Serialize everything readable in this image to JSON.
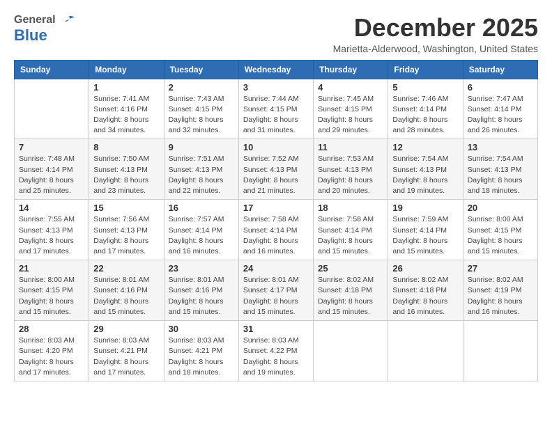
{
  "logo": {
    "general": "General",
    "blue": "Blue"
  },
  "header": {
    "month": "December 2025",
    "location": "Marietta-Alderwood, Washington, United States"
  },
  "days_of_week": [
    "Sunday",
    "Monday",
    "Tuesday",
    "Wednesday",
    "Thursday",
    "Friday",
    "Saturday"
  ],
  "weeks": [
    [
      {
        "day": "",
        "info": ""
      },
      {
        "day": "1",
        "info": "Sunrise: 7:41 AM\nSunset: 4:16 PM\nDaylight: 8 hours\nand 34 minutes."
      },
      {
        "day": "2",
        "info": "Sunrise: 7:43 AM\nSunset: 4:15 PM\nDaylight: 8 hours\nand 32 minutes."
      },
      {
        "day": "3",
        "info": "Sunrise: 7:44 AM\nSunset: 4:15 PM\nDaylight: 8 hours\nand 31 minutes."
      },
      {
        "day": "4",
        "info": "Sunrise: 7:45 AM\nSunset: 4:15 PM\nDaylight: 8 hours\nand 29 minutes."
      },
      {
        "day": "5",
        "info": "Sunrise: 7:46 AM\nSunset: 4:14 PM\nDaylight: 8 hours\nand 28 minutes."
      },
      {
        "day": "6",
        "info": "Sunrise: 7:47 AM\nSunset: 4:14 PM\nDaylight: 8 hours\nand 26 minutes."
      }
    ],
    [
      {
        "day": "7",
        "info": "Sunrise: 7:48 AM\nSunset: 4:14 PM\nDaylight: 8 hours\nand 25 minutes."
      },
      {
        "day": "8",
        "info": "Sunrise: 7:50 AM\nSunset: 4:13 PM\nDaylight: 8 hours\nand 23 minutes."
      },
      {
        "day": "9",
        "info": "Sunrise: 7:51 AM\nSunset: 4:13 PM\nDaylight: 8 hours\nand 22 minutes."
      },
      {
        "day": "10",
        "info": "Sunrise: 7:52 AM\nSunset: 4:13 PM\nDaylight: 8 hours\nand 21 minutes."
      },
      {
        "day": "11",
        "info": "Sunrise: 7:53 AM\nSunset: 4:13 PM\nDaylight: 8 hours\nand 20 minutes."
      },
      {
        "day": "12",
        "info": "Sunrise: 7:54 AM\nSunset: 4:13 PM\nDaylight: 8 hours\nand 19 minutes."
      },
      {
        "day": "13",
        "info": "Sunrise: 7:54 AM\nSunset: 4:13 PM\nDaylight: 8 hours\nand 18 minutes."
      }
    ],
    [
      {
        "day": "14",
        "info": "Sunrise: 7:55 AM\nSunset: 4:13 PM\nDaylight: 8 hours\nand 17 minutes."
      },
      {
        "day": "15",
        "info": "Sunrise: 7:56 AM\nSunset: 4:13 PM\nDaylight: 8 hours\nand 17 minutes."
      },
      {
        "day": "16",
        "info": "Sunrise: 7:57 AM\nSunset: 4:14 PM\nDaylight: 8 hours\nand 16 minutes."
      },
      {
        "day": "17",
        "info": "Sunrise: 7:58 AM\nSunset: 4:14 PM\nDaylight: 8 hours\nand 16 minutes."
      },
      {
        "day": "18",
        "info": "Sunrise: 7:58 AM\nSunset: 4:14 PM\nDaylight: 8 hours\nand 15 minutes."
      },
      {
        "day": "19",
        "info": "Sunrise: 7:59 AM\nSunset: 4:14 PM\nDaylight: 8 hours\nand 15 minutes."
      },
      {
        "day": "20",
        "info": "Sunrise: 8:00 AM\nSunset: 4:15 PM\nDaylight: 8 hours\nand 15 minutes."
      }
    ],
    [
      {
        "day": "21",
        "info": "Sunrise: 8:00 AM\nSunset: 4:15 PM\nDaylight: 8 hours\nand 15 minutes."
      },
      {
        "day": "22",
        "info": "Sunrise: 8:01 AM\nSunset: 4:16 PM\nDaylight: 8 hours\nand 15 minutes."
      },
      {
        "day": "23",
        "info": "Sunrise: 8:01 AM\nSunset: 4:16 PM\nDaylight: 8 hours\nand 15 minutes."
      },
      {
        "day": "24",
        "info": "Sunrise: 8:01 AM\nSunset: 4:17 PM\nDaylight: 8 hours\nand 15 minutes."
      },
      {
        "day": "25",
        "info": "Sunrise: 8:02 AM\nSunset: 4:18 PM\nDaylight: 8 hours\nand 15 minutes."
      },
      {
        "day": "26",
        "info": "Sunrise: 8:02 AM\nSunset: 4:18 PM\nDaylight: 8 hours\nand 16 minutes."
      },
      {
        "day": "27",
        "info": "Sunrise: 8:02 AM\nSunset: 4:19 PM\nDaylight: 8 hours\nand 16 minutes."
      }
    ],
    [
      {
        "day": "28",
        "info": "Sunrise: 8:03 AM\nSunset: 4:20 PM\nDaylight: 8 hours\nand 17 minutes."
      },
      {
        "day": "29",
        "info": "Sunrise: 8:03 AM\nSunset: 4:21 PM\nDaylight: 8 hours\nand 17 minutes."
      },
      {
        "day": "30",
        "info": "Sunrise: 8:03 AM\nSunset: 4:21 PM\nDaylight: 8 hours\nand 18 minutes."
      },
      {
        "day": "31",
        "info": "Sunrise: 8:03 AM\nSunset: 4:22 PM\nDaylight: 8 hours\nand 19 minutes."
      },
      {
        "day": "",
        "info": ""
      },
      {
        "day": "",
        "info": ""
      },
      {
        "day": "",
        "info": ""
      }
    ]
  ]
}
